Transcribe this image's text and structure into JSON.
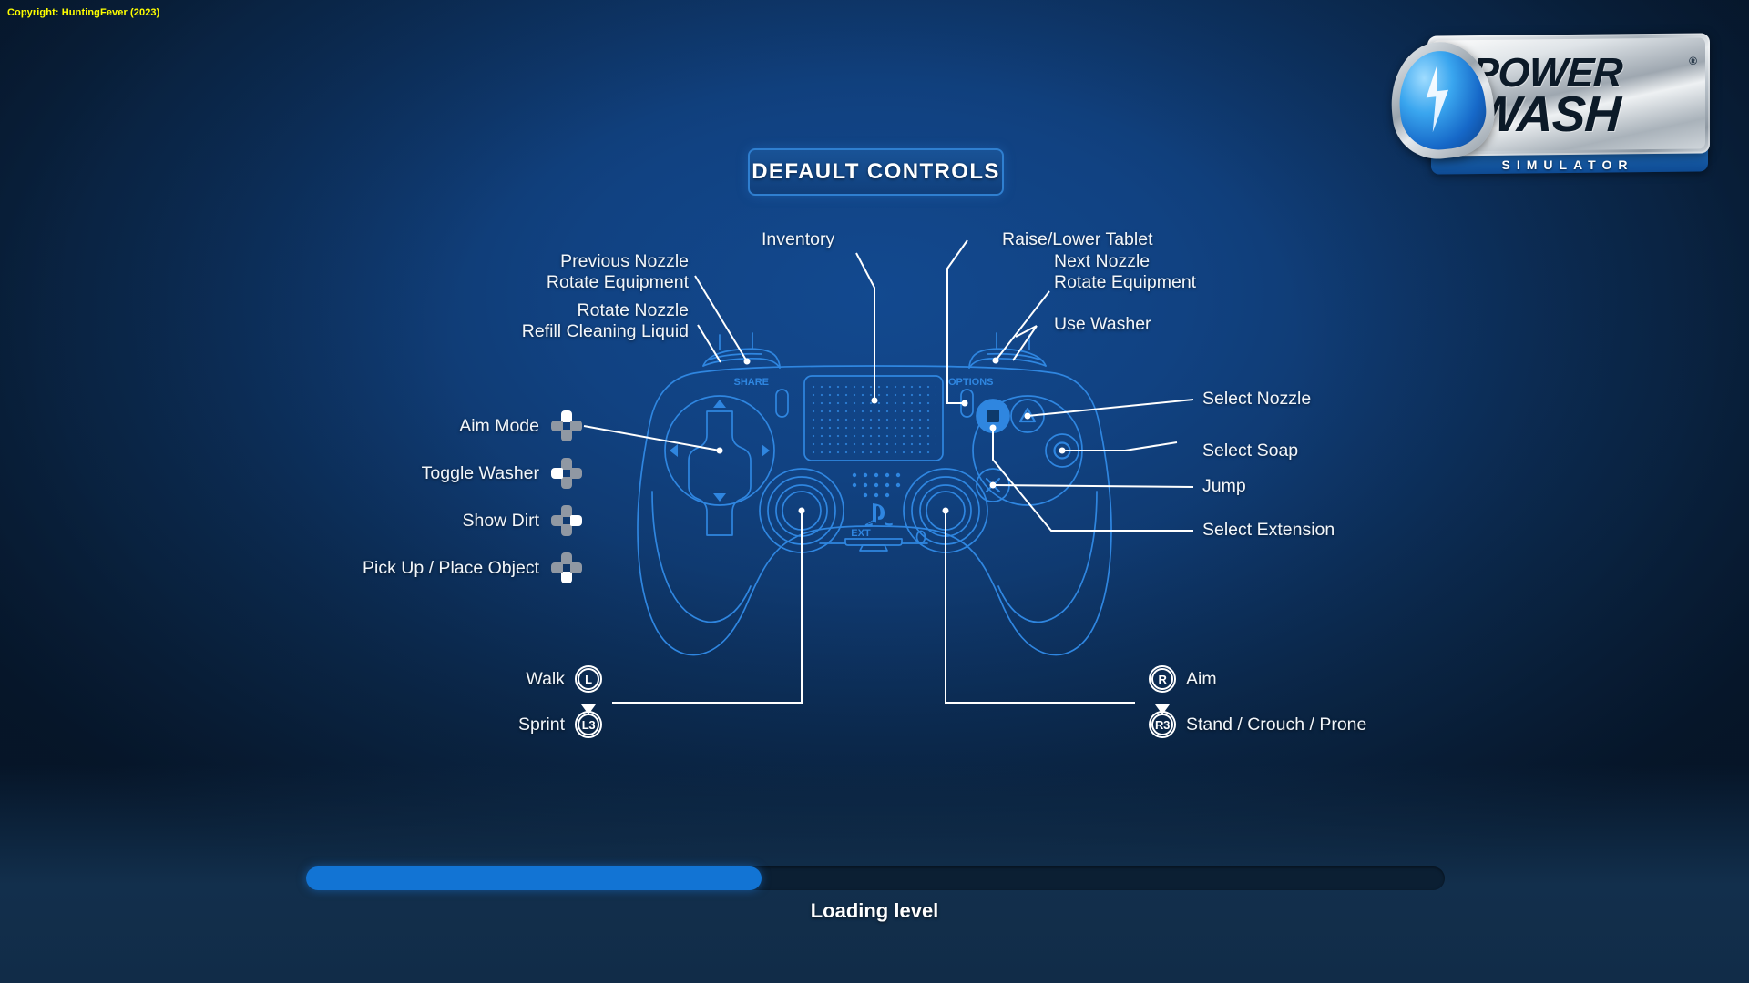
{
  "copyright": "Copyright: HuntingFever (2023)",
  "logo": {
    "line1": "POWER",
    "line2": "WASH",
    "registered": "®",
    "subtitle": "SIMULATOR",
    "drop_icon": "water-drop-bolt-icon"
  },
  "header": {
    "title": "DEFAULT CONTROLS"
  },
  "controller": {
    "type": "PlayStation DualShock 4",
    "share_label": "SHARE",
    "options_label": "OPTIONS",
    "ext_label": "EXT",
    "ps_logo": "playstation-logo-icon"
  },
  "callouts_top_left": [
    {
      "id": "l1-button",
      "lines": [
        "Previous Nozzle",
        "Rotate Equipment"
      ]
    },
    {
      "id": "l2-trigger",
      "lines": [
        "Rotate Nozzle",
        "Refill Cleaning Liquid"
      ]
    }
  ],
  "callouts_top_center": [
    {
      "id": "touchpad",
      "lines": [
        "Inventory"
      ]
    }
  ],
  "callouts_top_right": [
    {
      "id": "options-button",
      "lines": [
        "Raise/Lower Tablet"
      ]
    },
    {
      "id": "r1-button",
      "lines": [
        "Next Nozzle",
        "Rotate Equipment"
      ]
    },
    {
      "id": "r2-trigger",
      "lines": [
        "Use Washer"
      ]
    }
  ],
  "dpad_controls": [
    {
      "label": "Aim Mode",
      "direction": "up",
      "icon": "dpad-up-icon"
    },
    {
      "label": "Toggle Washer",
      "direction": "left",
      "icon": "dpad-left-icon"
    },
    {
      "label": "Show Dirt",
      "direction": "right",
      "icon": "dpad-right-icon"
    },
    {
      "label": "Pick Up / Place Object",
      "direction": "down",
      "icon": "dpad-down-icon"
    }
  ],
  "face_button_controls": [
    {
      "label": "Select Nozzle",
      "button": "triangle",
      "icon": "triangle-button-icon"
    },
    {
      "label": "Select Soap",
      "button": "circle",
      "icon": "circle-button-icon"
    },
    {
      "label": "Jump",
      "button": "cross",
      "icon": "cross-button-icon"
    },
    {
      "label": "Select Extension",
      "button": "square",
      "icon": "square-button-icon"
    }
  ],
  "stick_controls_left": [
    {
      "label": "Walk",
      "glyph": "L",
      "icon": "left-stick-icon",
      "press": false
    },
    {
      "label": "Sprint",
      "glyph": "L3",
      "icon": "left-stick-press-icon",
      "press": true
    }
  ],
  "stick_controls_right": [
    {
      "label": "Aim",
      "glyph": "R",
      "icon": "right-stick-icon",
      "press": false
    },
    {
      "label": "Stand / Crouch / Prone",
      "glyph": "R3",
      "icon": "right-stick-press-icon",
      "press": true
    }
  ],
  "loading": {
    "label": "Loading level",
    "percent": 40,
    "fill_color": "#1274d4",
    "track_color": "#0b1f33"
  },
  "colors": {
    "background_center": "#12498f",
    "background_edge": "#0b223c",
    "bottom_panel": "#112c48",
    "accent_blue": "#2f7fd0",
    "wireframe_blue": "#2f86e0",
    "text_white": "#f2f6fa",
    "copyright_yellow": "#ffff00",
    "dpad_grey": "#9098a3"
  }
}
